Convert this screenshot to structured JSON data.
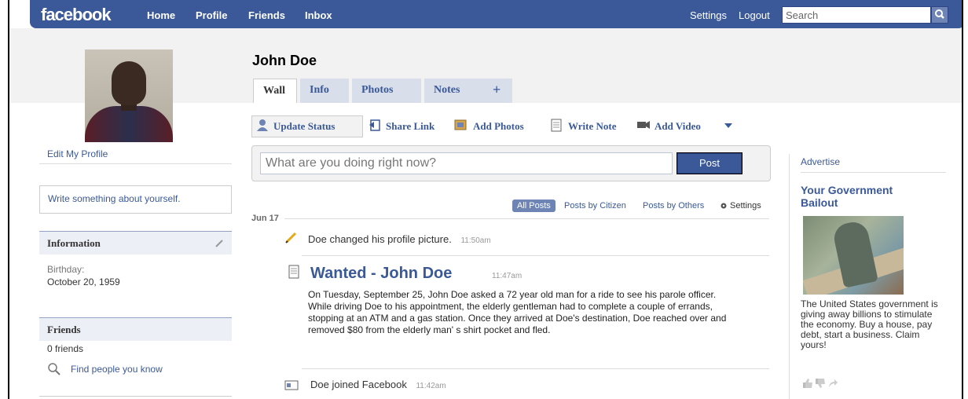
{
  "header": {
    "logo": "facebook",
    "nav": [
      "Home",
      "Profile",
      "Friends",
      "Inbox"
    ],
    "settings": "Settings",
    "logout": "Logout",
    "search_placeholder": "Search"
  },
  "profile": {
    "name": "John Doe",
    "edit_link": "Edit My Profile",
    "about_prompt": "Write something about yourself.",
    "information": {
      "header": "Information",
      "birthday_label": "Birthday:",
      "birthday_value": "October 20, 1959"
    },
    "friends": {
      "header": "Friends",
      "count": "0 friends",
      "find": "Find people you know"
    }
  },
  "tabs": [
    "Wall",
    "Info",
    "Photos",
    "Notes",
    "+"
  ],
  "actions": {
    "update_status": "Update Status",
    "share_link": "Share Link",
    "add_photos": "Add Photos",
    "write_note": "Write Note",
    "add_video": "Add Video"
  },
  "composer": {
    "placeholder": "What are you doing right now?",
    "post": "Post"
  },
  "filters": {
    "all": "All Posts",
    "by_citizen": "Posts by Citizen",
    "by_others": "Posts by Others",
    "settings": "Settings"
  },
  "feed": {
    "date": "Jun 17",
    "items": [
      {
        "text": "Doe changed his profile picture.",
        "time": "11:50am"
      },
      {
        "title": "Wanted - John Doe",
        "time": "11:47am",
        "body": "On Tuesday, September 25, John Doe asked a 72 year old man for a ride to see his parole officer.  While driving Doe to his appointment, the elderly gentleman had to complete a couple of errands, stopping at an ATM and a gas station.  Once they arrived at Doe's destination, Doe reached over and removed $80 from the elderly man' s shirt pocket and fled."
      },
      {
        "text": "Doe joined Facebook",
        "time": "11:42am"
      }
    ]
  },
  "ad": {
    "header": "Advertise",
    "title": "Your Government Bailout",
    "body": "The United States government is giving away billions to stimulate the economy. Buy a house, pay debt, start a business. Claim yours!"
  },
  "colors": {
    "brand": "#3b5998",
    "tab_bg": "#d8dfea",
    "sidebar_header": "#eceff5"
  }
}
